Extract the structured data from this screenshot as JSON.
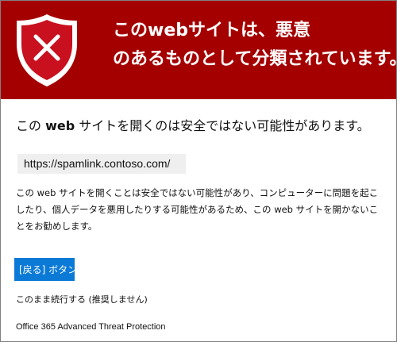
{
  "banner": {
    "icon": "shield-x-icon",
    "title_line1": "このwebサイトは、悪意",
    "title_line2": "のあるものとして分類されています。",
    "color": "#a50000"
  },
  "headline": {
    "prefix": "この ",
    "web": "web",
    "suffix": " サイトを開くのは安全ではない可能性があります。"
  },
  "url": "https://spamlink.contoso.com/",
  "description": "この web サイトを開くことは安全ではない可能性があり、コンピューターに問題を起こしたり、個人データを悪用したりする可能性があるため、この web サイトを開かないことをお勧めします。",
  "back_button": {
    "label": "[戻る] ボタン",
    "color": "#0a7ad6"
  },
  "continue_link": "このまま続行する (推奨しません)",
  "footer": "Office 365 Advanced Threat Protection"
}
